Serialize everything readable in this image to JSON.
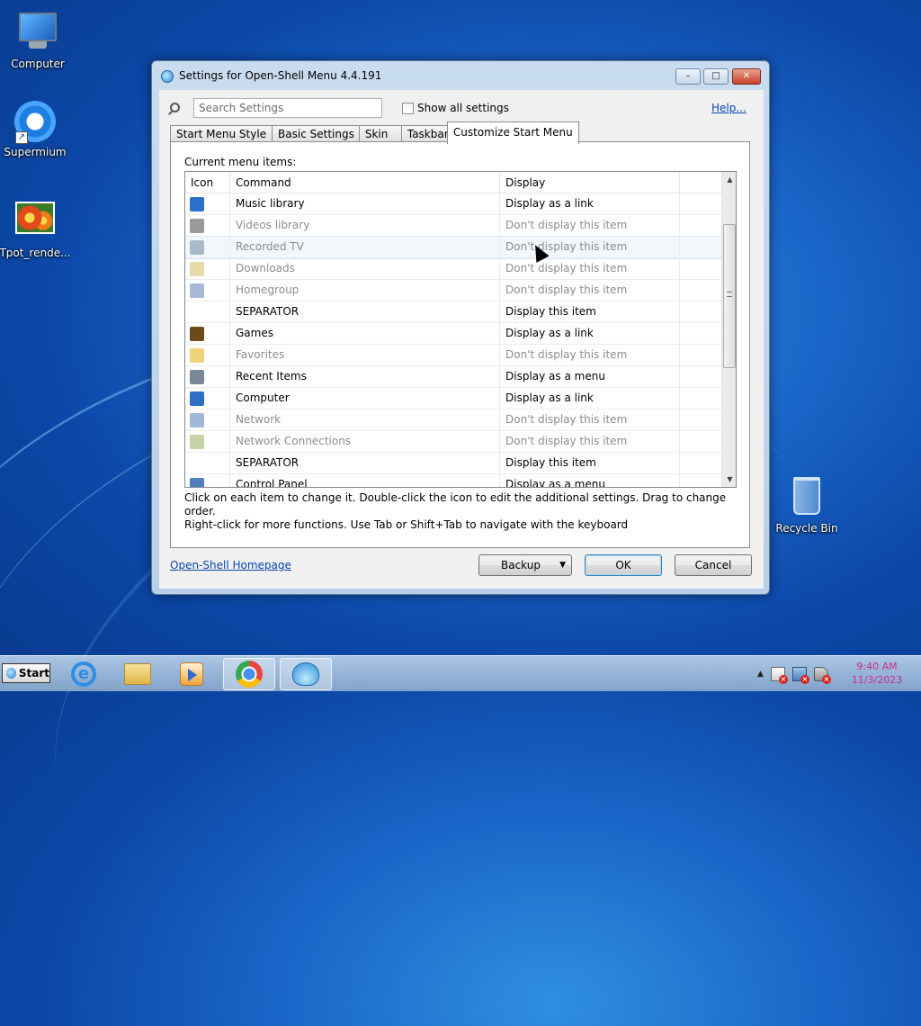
{
  "desktop": {
    "icons": [
      {
        "label": "Computer"
      },
      {
        "label": "Supermium"
      },
      {
        "label": "Tpot_rende..."
      },
      {
        "label": "Recycle Bin"
      }
    ]
  },
  "window": {
    "title": "Settings for Open-Shell Menu 4.4.191",
    "controls": {
      "minimize": "–",
      "maximize": "□",
      "close": "✕"
    },
    "search": {
      "placeholder": "Search Settings",
      "value": ""
    },
    "show_all_label": "Show all settings",
    "show_all_checked": false,
    "help_label": "Help...",
    "tabs": [
      {
        "label": "Start Menu Style",
        "active": false
      },
      {
        "label": "Basic Settings",
        "active": false
      },
      {
        "label": "Skin",
        "active": false
      },
      {
        "label": "Taskbar",
        "active": false
      },
      {
        "label": "Customize Start Menu",
        "active": true
      }
    ],
    "current_items_label": "Current menu items:",
    "columns": [
      "Icon",
      "Command",
      "Display"
    ],
    "rows": [
      {
        "command": "Music library",
        "display": "Display as a link",
        "dim": false,
        "icon": "music-icon",
        "color": "#2a6fc9"
      },
      {
        "command": "Videos library",
        "display": "Don't display this item",
        "dim": true,
        "icon": "video-icon",
        "color": "#9a9a9a"
      },
      {
        "command": "Recorded TV",
        "display": "Don't display this item",
        "dim": true,
        "icon": "tv-icon",
        "color": "#aab9c8",
        "hover": true
      },
      {
        "command": "Downloads",
        "display": "Don't display this item",
        "dim": true,
        "icon": "downloads-icon",
        "color": "#e7d9a8"
      },
      {
        "command": "Homegroup",
        "display": "Don't display this item",
        "dim": true,
        "icon": "homegroup-icon",
        "color": "#a8b8d8"
      },
      {
        "command": "SEPARATOR",
        "display": "Display this item",
        "dim": false,
        "icon": "",
        "color": ""
      },
      {
        "command": "Games",
        "display": "Display as a link",
        "dim": false,
        "icon": "games-icon",
        "color": "#6b4a1c"
      },
      {
        "command": "Favorites",
        "display": "Don't display this item",
        "dim": true,
        "icon": "star-icon",
        "color": "#f0d27a"
      },
      {
        "command": "Recent Items",
        "display": "Display as a menu",
        "dim": false,
        "icon": "recent-items-icon",
        "color": "#7a8796"
      },
      {
        "command": "Computer",
        "display": "Display as a link",
        "dim": false,
        "icon": "computer-icon",
        "color": "#2d6fc4"
      },
      {
        "command": "Network",
        "display": "Don't display this item",
        "dim": true,
        "icon": "network-icon",
        "color": "#9fb8d8"
      },
      {
        "command": "Network Connections",
        "display": "Don't display this item",
        "dim": true,
        "icon": "network-connections-icon",
        "color": "#c7d3a6"
      },
      {
        "command": "SEPARATOR",
        "display": "Display this item",
        "dim": false,
        "icon": "",
        "color": ""
      },
      {
        "command": "Control Panel",
        "display": "Display as a menu",
        "dim": false,
        "icon": "control-panel-icon",
        "color": "#4e7fb8"
      }
    ],
    "hint_line1": "Click on each item to change it. Double-click the icon to edit the additional settings. Drag to change order.",
    "hint_line2": "Right-click for more functions. Use Tab or Shift+Tab to navigate with the keyboard",
    "homepage_label": "Open-Shell Homepage",
    "backup_label": "Backup",
    "ok_label": "OK",
    "cancel_label": "Cancel"
  },
  "taskbar": {
    "start_label": "Start",
    "ie_glyph": "e",
    "clock_time": "9:40 AM",
    "clock_date": "11/3/2023",
    "tray_up": "▲"
  }
}
